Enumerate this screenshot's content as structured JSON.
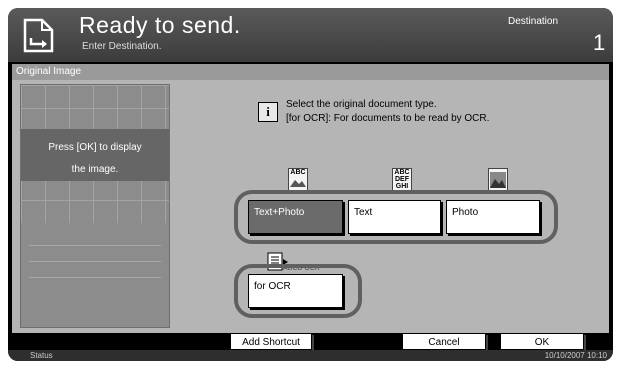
{
  "header": {
    "title": "Ready to send.",
    "subtitle": "Enter Destination.",
    "destination_label": "Destination",
    "destination_count": "1"
  },
  "panel": {
    "title": "Original Image",
    "preview_message_line1": "Press [OK] to display",
    "preview_message_line2": "the image.",
    "instruction_line1": "Select the original document type.",
    "instruction_line2": "[for OCR]: For documents to be read by OCR.",
    "info_icon": "i"
  },
  "options": [
    {
      "label": "Text+Photo",
      "selected": true,
      "icon": "text-photo-doc-icon",
      "icon_text": "ABC"
    },
    {
      "label": "Text",
      "selected": false,
      "icon": "text-doc-icon",
      "icon_text": "ABC DEF GHI"
    },
    {
      "label": "Photo",
      "selected": false,
      "icon": "photo-doc-icon"
    }
  ],
  "ocr_option": {
    "label": "for OCR",
    "selected": false,
    "icon": "ocr-doc-icon",
    "icon_text": "ABCD OCR"
  },
  "footer": {
    "add_shortcut_label": "Add Shortcut",
    "cancel_label": "Cancel",
    "ok_label": "OK"
  },
  "status": {
    "label": "Status",
    "datetime": "10/10/2007  10:10"
  },
  "colors": {
    "header_bg": "#4a4a4a",
    "panel_bg": "#b5b5b5",
    "selected_button": "#6b6b6b"
  }
}
